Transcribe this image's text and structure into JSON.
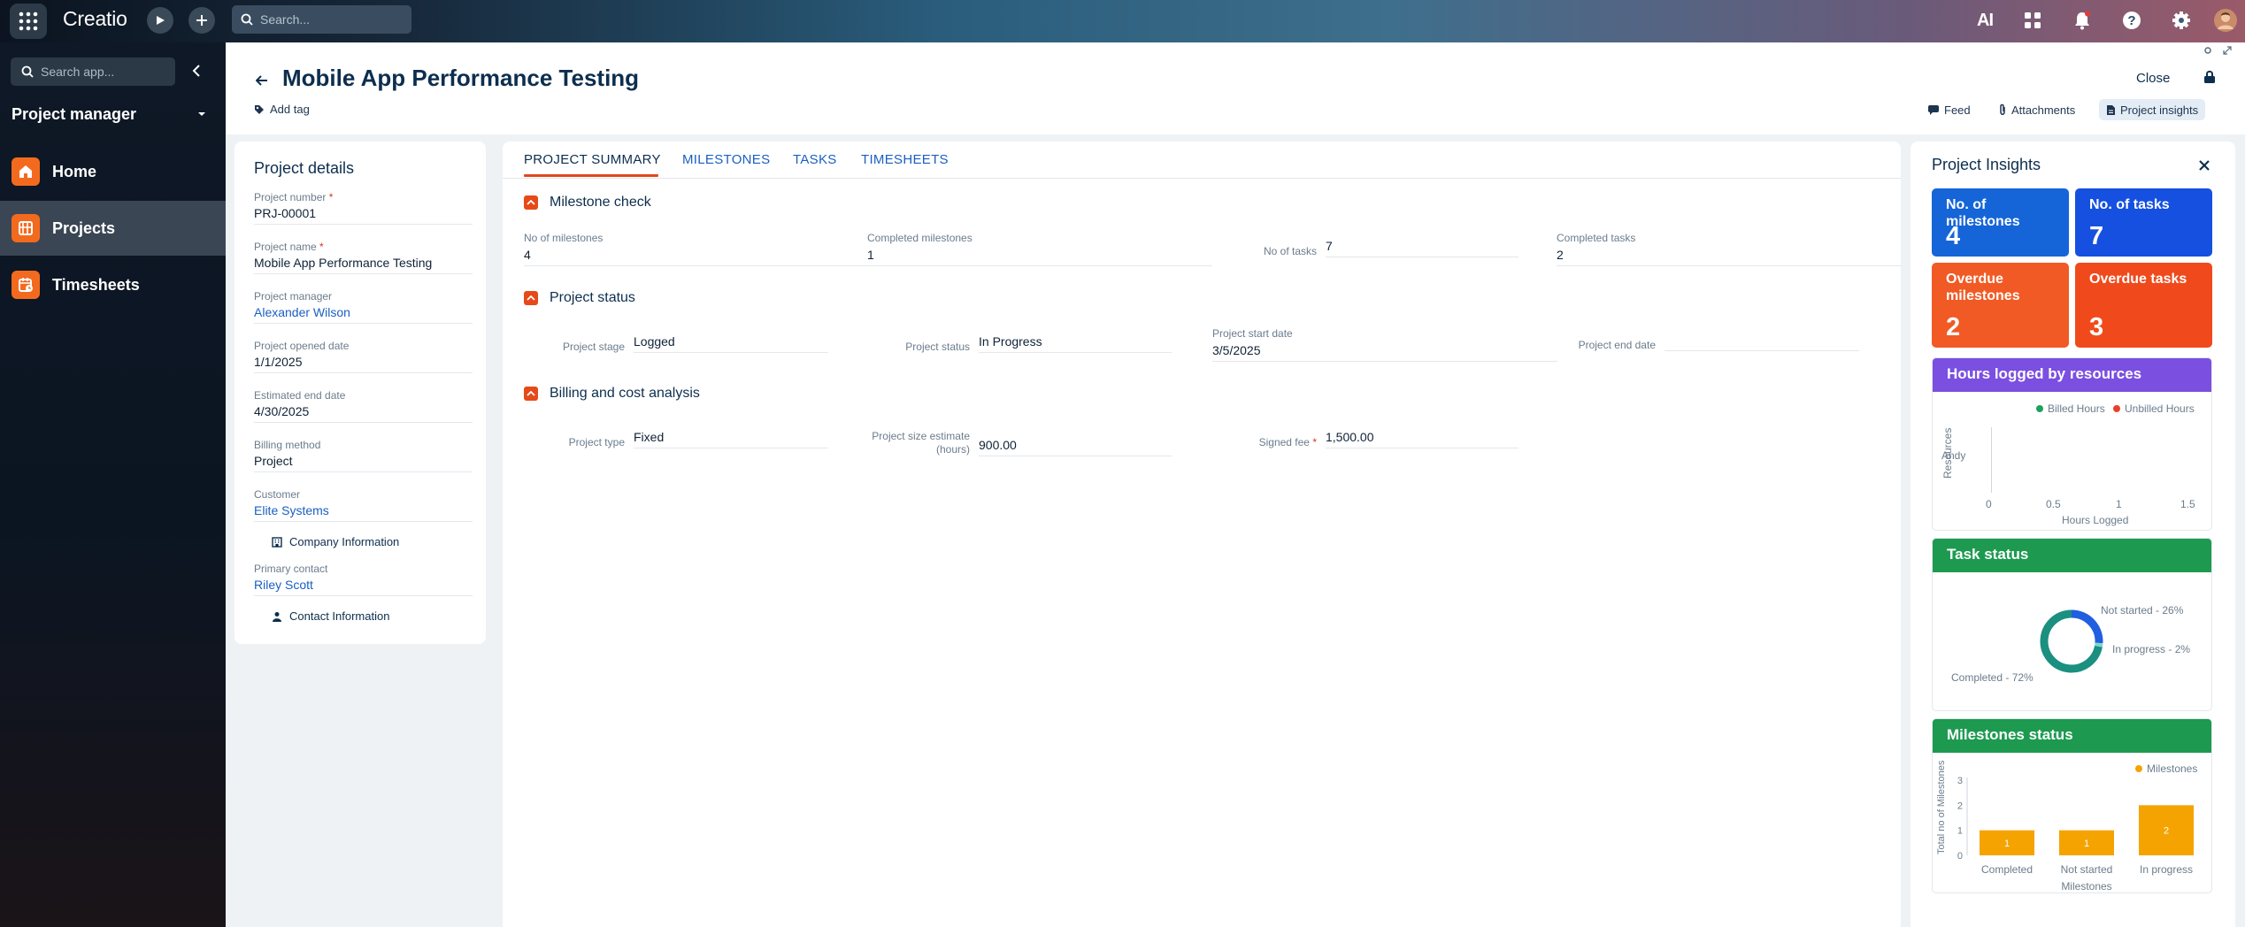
{
  "topbar": {
    "logo": "Creatio",
    "search_placeholder": "Search...",
    "ai_label": "AI"
  },
  "sidebar": {
    "search_placeholder": "Search app...",
    "workplace": "Project manager",
    "items": [
      {
        "label": "Home",
        "icon": "home-icon"
      },
      {
        "label": "Projects",
        "icon": "projects-icon",
        "active": true
      },
      {
        "label": "Timesheets",
        "icon": "timesheets-icon"
      }
    ]
  },
  "header": {
    "title": "Mobile App Performance Testing",
    "add_tag": "Add tag",
    "close": "Close",
    "actions": {
      "feed": "Feed",
      "attachments": "Attachments",
      "insights": "Project insights"
    }
  },
  "details": {
    "heading": "Project details",
    "fields": [
      {
        "caption": "Project number",
        "value": "PRJ-00001",
        "required": true
      },
      {
        "caption": "Project name",
        "value": "Mobile App Performance Testing",
        "required": true
      },
      {
        "caption": "Project manager",
        "value": "Alexander Wilson",
        "link": true
      },
      {
        "caption": "Project opened date",
        "value": "1/1/2025"
      },
      {
        "caption": "Estimated end date",
        "value": "4/30/2025"
      },
      {
        "caption": "Billing method",
        "value": "Project"
      },
      {
        "caption": "Customer",
        "value": "Elite Systems",
        "link": true
      },
      {
        "caption": "Primary contact",
        "value": "Riley Scott",
        "link": true
      }
    ],
    "company_info": "Company Information",
    "contact_info": "Contact Information"
  },
  "tabs": [
    "PROJECT SUMMARY",
    "MILESTONES",
    "TASKS",
    "TIMESHEETS"
  ],
  "summary": {
    "milestone_section": "Milestone check",
    "milestone_fields": [
      {
        "caption": "No of milestones",
        "value": "4"
      },
      {
        "caption": "Completed milestones",
        "value": "1"
      },
      {
        "caption": "No of tasks",
        "value": "7"
      },
      {
        "caption": "Completed tasks",
        "value": "2"
      }
    ],
    "status_section": "Project status",
    "status_fields": [
      {
        "caption": "Project stage",
        "value": "Logged"
      },
      {
        "caption": "Project status",
        "value": "In Progress"
      },
      {
        "caption": "Project start date",
        "value": "3/5/2025"
      },
      {
        "caption": "Project end date",
        "value": ""
      }
    ],
    "billing_section": "Billing and cost analysis",
    "billing_fields": [
      {
        "caption": "Project type",
        "value": "Fixed"
      },
      {
        "caption": "Project size estimate (hours)",
        "value": "900.00"
      },
      {
        "caption": "Signed fee",
        "value": "1,500.00",
        "required": true
      }
    ]
  },
  "insights": {
    "title": "Project Insights",
    "kpis": [
      {
        "label": "No. of milestones",
        "value": "4",
        "color": "#1565d8"
      },
      {
        "label": "No. of tasks",
        "value": "7",
        "color": "#1550e0"
      },
      {
        "label": "Overdue milestones",
        "value": "2",
        "color": "#f15a24"
      },
      {
        "label": "Overdue tasks",
        "value": "3",
        "color": "#f04a1c"
      }
    ],
    "hours_title": "Hours logged by resources",
    "tasks_title": "Task status",
    "milestones_title": "Milestones status"
  },
  "chart_data": [
    {
      "type": "bar",
      "title": "Hours logged by resources",
      "categories": [
        "Andy"
      ],
      "series": [
        {
          "name": "Billed Hours",
          "values": [
            0
          ]
        },
        {
          "name": "Unbilled Hours",
          "values": [
            0
          ]
        }
      ],
      "xlabel": "Hours Logged",
      "ylabel": "Resources",
      "xticks": [
        "0",
        "0.5",
        "1",
        "1.5"
      ],
      "xlim": [
        0,
        1.5
      ],
      "colors": [
        "#1ea060",
        "#e8402a"
      ],
      "legend": "top-right"
    },
    {
      "type": "pie",
      "title": "Task status",
      "slices": [
        {
          "label": "Not started - 26%",
          "value": 26,
          "color": "#1f5fe0"
        },
        {
          "label": "In progress - 2%",
          "value": 2,
          "color": "#7fd6c8"
        },
        {
          "label": "Completed - 72%",
          "value": 72,
          "color": "#1b8f80"
        }
      ]
    },
    {
      "type": "bar",
      "title": "Milestones status",
      "categories": [
        "Completed",
        "Not started",
        "In progress"
      ],
      "series": [
        {
          "name": "Milestones",
          "values": [
            1,
            1,
            2
          ]
        }
      ],
      "xlabel": "Milestones",
      "ylabel": "Total no of Milestones",
      "yticks": [
        "0",
        "1",
        "2",
        "3"
      ],
      "ylim": [
        0,
        3
      ],
      "color": "#f5a300",
      "legend": "top-right"
    }
  ]
}
